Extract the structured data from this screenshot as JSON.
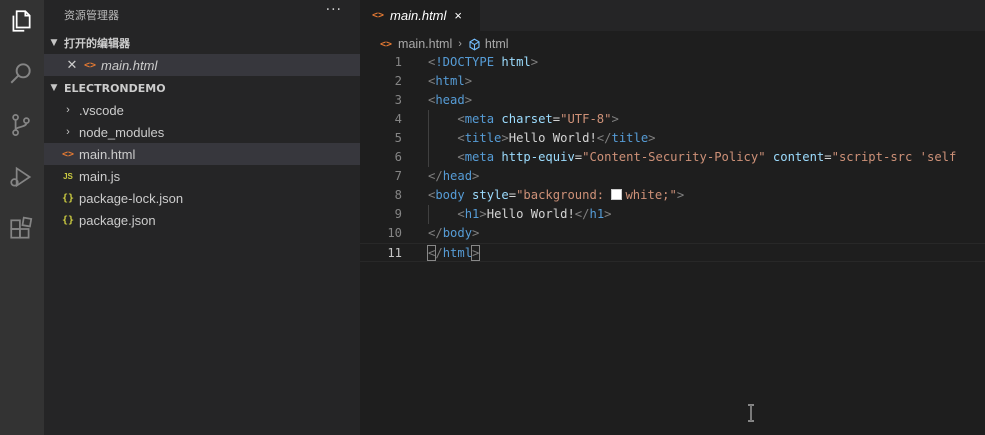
{
  "sidebar": {
    "title": "资源管理器",
    "more": "···",
    "open_editors": {
      "header": "打开的编辑器",
      "items": [
        {
          "name": "main.html"
        }
      ]
    },
    "workspace": {
      "header": "ELECTRONDEMO",
      "items": [
        {
          "name": ".vscode",
          "kind": "folder"
        },
        {
          "name": "node_modules",
          "kind": "folder"
        },
        {
          "name": "main.html",
          "kind": "html",
          "selected": true
        },
        {
          "name": "main.js",
          "kind": "js"
        },
        {
          "name": "package-lock.json",
          "kind": "json"
        },
        {
          "name": "package.json",
          "kind": "json"
        }
      ]
    }
  },
  "editor": {
    "tab": {
      "label": "main.html",
      "close": "×"
    },
    "breadcrumb": {
      "file": "main.html",
      "sep": "›",
      "symbol": "html"
    },
    "icons": {
      "html": "<>",
      "js": "JS",
      "json": "{}"
    },
    "lines": [
      {
        "n": "1",
        "tokens": [
          [
            "t-punct",
            "<"
          ],
          [
            "t-doctype",
            "!DOCTYPE"
          ],
          [
            "t-text",
            " "
          ],
          [
            "t-attr",
            "html"
          ],
          [
            "t-punct",
            ">"
          ]
        ]
      },
      {
        "n": "2",
        "tokens": [
          [
            "t-punct",
            "<"
          ],
          [
            "t-tag",
            "html"
          ],
          [
            "t-punct",
            ">"
          ]
        ]
      },
      {
        "n": "3",
        "tokens": [
          [
            "t-punct",
            "<"
          ],
          [
            "t-tag",
            "head"
          ],
          [
            "t-punct",
            ">"
          ]
        ]
      },
      {
        "n": "4",
        "tokens": [
          [
            "t-text",
            "    "
          ],
          [
            "t-punct",
            "<"
          ],
          [
            "t-tag",
            "meta"
          ],
          [
            "t-text",
            " "
          ],
          [
            "t-attr",
            "charset"
          ],
          [
            "t-text",
            "="
          ],
          [
            "t-str",
            "\"UTF-8\""
          ],
          [
            "t-punct",
            ">"
          ]
        ]
      },
      {
        "n": "5",
        "tokens": [
          [
            "t-text",
            "    "
          ],
          [
            "t-punct",
            "<"
          ],
          [
            "t-tag",
            "title"
          ],
          [
            "t-punct",
            ">"
          ],
          [
            "t-text",
            "Hello World!"
          ],
          [
            "t-punct",
            "</"
          ],
          [
            "t-tag",
            "title"
          ],
          [
            "t-punct",
            ">"
          ]
        ]
      },
      {
        "n": "6",
        "tokens": [
          [
            "t-text",
            "    "
          ],
          [
            "t-punct",
            "<"
          ],
          [
            "t-tag",
            "meta"
          ],
          [
            "t-text",
            " "
          ],
          [
            "t-attr",
            "http-equiv"
          ],
          [
            "t-text",
            "="
          ],
          [
            "t-str",
            "\"Content-Security-Policy\""
          ],
          [
            "t-text",
            " "
          ],
          [
            "t-attr",
            "content"
          ],
          [
            "t-text",
            "="
          ],
          [
            "t-str",
            "\"script-src 'self"
          ]
        ]
      },
      {
        "n": "7",
        "tokens": [
          [
            "t-punct",
            "</"
          ],
          [
            "t-tag",
            "head"
          ],
          [
            "t-punct",
            ">"
          ]
        ]
      },
      {
        "n": "8",
        "tokens": [
          [
            "t-punct",
            "<"
          ],
          [
            "t-tag",
            "body"
          ],
          [
            "t-text",
            " "
          ],
          [
            "t-attr",
            "style"
          ],
          [
            "t-text",
            "="
          ],
          [
            "t-str",
            "\"background: "
          ],
          [
            "swatch",
            ""
          ],
          [
            "t-str",
            "white;\""
          ],
          [
            "t-punct",
            ">"
          ]
        ]
      },
      {
        "n": "9",
        "tokens": [
          [
            "t-text",
            "    "
          ],
          [
            "t-punct",
            "<"
          ],
          [
            "t-tag",
            "h1"
          ],
          [
            "t-punct",
            ">"
          ],
          [
            "t-text",
            "Hello World!"
          ],
          [
            "t-punct",
            "</"
          ],
          [
            "t-tag",
            "h1"
          ],
          [
            "t-punct",
            ">"
          ]
        ]
      },
      {
        "n": "10",
        "tokens": [
          [
            "t-punct",
            "</"
          ],
          [
            "t-tag",
            "body"
          ],
          [
            "t-punct",
            ">"
          ]
        ]
      },
      {
        "n": "11",
        "current": true,
        "tokens": [
          [
            "t-punct match",
            "<"
          ],
          [
            "t-punct",
            "/"
          ],
          [
            "t-tag",
            "html"
          ],
          [
            "t-punct match",
            ">"
          ]
        ]
      }
    ]
  },
  "colors": {
    "activity_bar": "#333333",
    "sidebar": "#252526",
    "editor": "#1e1e1e",
    "selected_row": "#37373d",
    "html_icon": "#e37933",
    "json_icon": "#cbcb41"
  }
}
